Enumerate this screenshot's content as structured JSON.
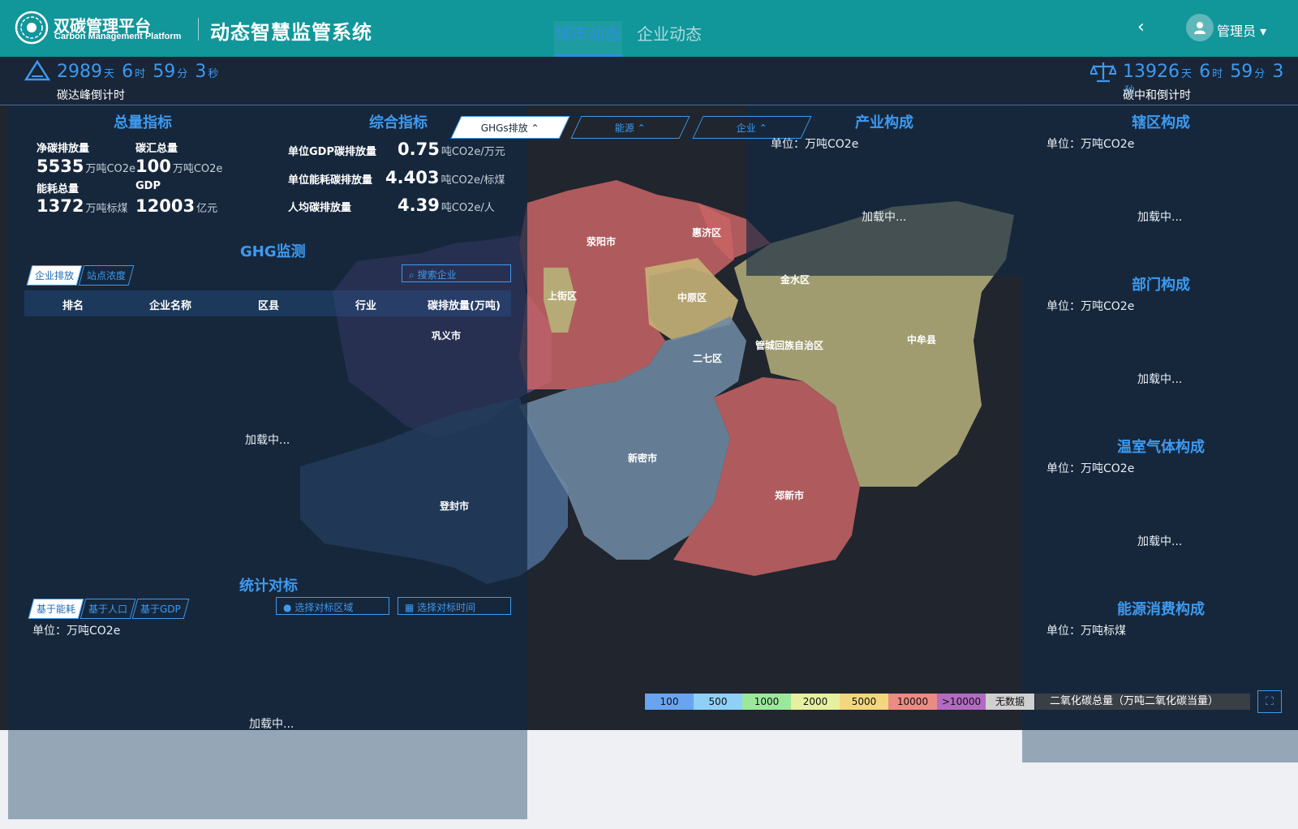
{
  "header": {
    "logo_title": "双碳管理平台",
    "logo_subtitle": "Carbon Management Platform",
    "system_title": "动态智慧监管系统",
    "tabs": [
      "城市动态",
      "企业动态"
    ],
    "back_icon": "chevron-left-icon",
    "user_name": "管理员",
    "user_icon": "user-icon"
  },
  "countdown_peak": {
    "days": "2989",
    "hours": "6",
    "minutes": "59",
    "seconds": "3",
    "unit_day": "天",
    "unit_hour": "时",
    "unit_min": "分",
    "unit_sec": "秒",
    "label": "碳达峰倒计时"
  },
  "countdown_neutral": {
    "days": "13926",
    "hours": "6",
    "minutes": "59",
    "seconds": "3",
    "unit_day": "天",
    "unit_hour": "时",
    "unit_min": "分",
    "unit_sec": "秒",
    "label": "碳中和倒计时"
  },
  "total_indicators": {
    "title": "总量指标",
    "net_emission_label": "净碳排放量",
    "net_emission_value": "5535",
    "net_emission_unit": "万吨CO2e",
    "sink_label": "碳汇总量",
    "sink_value": "100",
    "sink_unit": "万吨CO2e",
    "energy_label": "能耗总量",
    "energy_value": "1372",
    "energy_unit": "万吨标煤",
    "gdp_label": "GDP",
    "gdp_value": "12003",
    "gdp_unit": "亿元"
  },
  "composite_indicators": {
    "title": "综合指标",
    "gdp_intensity_label": "单位GDP碳排放量",
    "gdp_intensity_value": "0.75",
    "gdp_intensity_unit": "吨CO2e/万元",
    "energy_intensity_label": "单位能耗碳排放量",
    "energy_intensity_value": "4.403",
    "energy_intensity_unit": "吨CO2e/标煤",
    "per_capita_label": "人均碳排放量",
    "per_capita_value": "4.39",
    "per_capita_unit": "吨CO2e/人"
  },
  "ghg_monitor": {
    "title": "GHG监测",
    "tabs": [
      "企业排放",
      "站点浓度"
    ],
    "search_label": "搜索企业",
    "columns": [
      "排名",
      "企业名称",
      "区县",
      "行业",
      "碳排放量(万吨)"
    ],
    "loading": "加载中..."
  },
  "benchmark": {
    "title": "统计对标",
    "tabs": [
      "基于能耗",
      "基于人口",
      "基于GDP"
    ],
    "select_region": "选择对标区域",
    "select_time": "选择对标时间",
    "unit": "单位：万吨CO2e",
    "loading": "加载中..."
  },
  "map": {
    "filters": [
      "GHGs排放",
      "能源",
      "企业"
    ],
    "regions": [
      "荥阳市",
      "惠济区",
      "金水区",
      "上街区",
      "中原区",
      "巩义市",
      "二七区",
      "管城回族自治区",
      "中牟县",
      "新密市",
      "登封市",
      "郑新市"
    ],
    "region_colors": {
      "red": "#c96464",
      "yellow": "#b7b27a",
      "purple": "#6e4c8a",
      "blue": "#4e6f97",
      "steel": "#6d8aa3"
    },
    "legend": [
      "100",
      "500",
      "1000",
      "2000",
      "5000",
      "10000",
      ">10000",
      "无数据"
    ],
    "legend_colors": [
      "#6aa4f0",
      "#8fd0f7",
      "#9be89b",
      "#e6f0a0",
      "#f2d77f",
      "#ec8b84",
      "#b26bc0",
      "#d0d0d0"
    ],
    "legend_title": "二氧化碳总量（万吨二氧化碳当量）",
    "fullscreen_icon": "fullscreen-icon"
  },
  "industry": {
    "title": "产业构成",
    "unit": "单位：万吨CO2e",
    "loading": "加载中..."
  },
  "district": {
    "title": "辖区构成",
    "unit": "单位：万吨CO2e",
    "loading": "加载中..."
  },
  "department": {
    "title": "部门构成",
    "unit": "单位：万吨CO2e",
    "loading": "加载中..."
  },
  "ghg_composition": {
    "title": "温室气体构成",
    "unit": "单位：万吨CO2e",
    "loading": "加载中..."
  },
  "energy_consumption": {
    "title": "能源消费构成",
    "unit": "单位：万吨标煤",
    "loading": "加载中..."
  }
}
